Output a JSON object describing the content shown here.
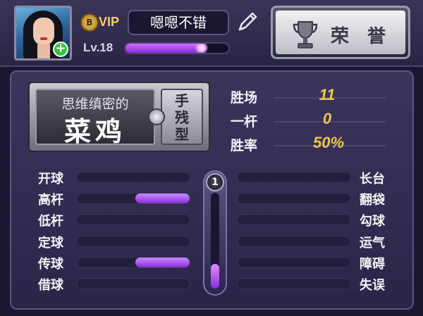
{
  "header": {
    "vip_badge": "B",
    "vip_label": "VIP",
    "player_name": "嗯嗯不错",
    "level_label": "Lv.18",
    "xp_fraction": 0.76,
    "honor_label": "荣誉"
  },
  "title": {
    "small": "思维缜密的",
    "big": "菜鸡",
    "side": "手残型"
  },
  "stats": [
    {
      "label": "胜场",
      "value": "11"
    },
    {
      "label": "一杆",
      "value": "0"
    },
    {
      "label": "胜率",
      "value": "50%"
    }
  ],
  "skills_left": [
    {
      "label": "开球",
      "level": 0
    },
    {
      "label": "高杆",
      "level": 0.48
    },
    {
      "label": "低杆",
      "level": 0
    },
    {
      "label": "定球",
      "level": 0
    },
    {
      "label": "传球",
      "level": 0.48
    },
    {
      "label": "借球",
      "level": 0
    }
  ],
  "skills_right": [
    {
      "label": "长台",
      "level": 0
    },
    {
      "label": "翻袋",
      "level": 0
    },
    {
      "label": "勾球",
      "level": 0
    },
    {
      "label": "运气",
      "level": 0
    },
    {
      "label": "障碍",
      "level": 0
    },
    {
      "label": "失误",
      "level": 0
    }
  ],
  "cue": {
    "level_label": "1",
    "fill_fraction": 0.26
  },
  "colors": {
    "accent_purple": "#a64cf0",
    "stat_gold": "#f0c64a",
    "panel_bg": "#2f2a4e"
  },
  "icons": [
    "add-friend-icon",
    "vip-badge-icon",
    "edit-pencil-icon",
    "trophy-icon",
    "gem-icon"
  ]
}
